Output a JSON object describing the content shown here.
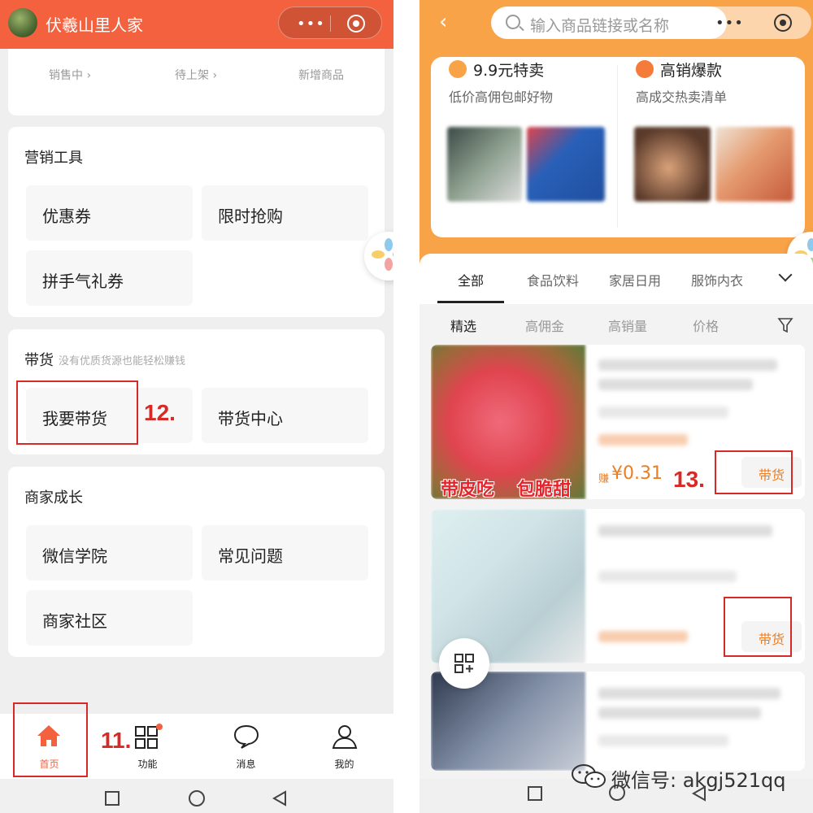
{
  "left": {
    "header": {
      "shop_name": "伏羲山里人家"
    },
    "stats": [
      "销售中 ›",
      "待上架 ›",
      "新增商品"
    ],
    "marketing": {
      "title": "营销工具",
      "items": [
        "优惠券",
        "限时抢购",
        "拼手气礼券"
      ]
    },
    "daihuo": {
      "title": "带货",
      "subtitle": "没有优质货源也能轻松赚钱",
      "items": [
        "我要带货",
        "带货中心"
      ]
    },
    "growth": {
      "title": "商家成长",
      "items": [
        "微信学院",
        "常见问题",
        "商家社区"
      ]
    },
    "tabbar": [
      {
        "label": "首页",
        "icon": "home-icon",
        "active": true
      },
      {
        "label": "功能",
        "icon": "grid-icon",
        "active": false
      },
      {
        "label": "消息",
        "icon": "chat-icon",
        "active": false
      },
      {
        "label": "我的",
        "icon": "user-icon",
        "active": false
      }
    ],
    "step_labels": {
      "home": "11.",
      "daihuo": "12."
    },
    "accent": "#f4613f"
  },
  "right": {
    "search": {
      "placeholder": "输入商品链接或名称"
    },
    "promo": [
      {
        "title": "9.9元特卖",
        "subtitle": "低价高佣包邮好物"
      },
      {
        "title": "高销爆款",
        "subtitle": "高成交热卖清单"
      }
    ],
    "categories": [
      "全部",
      "食品饮料",
      "家居日用",
      "服饰内衣"
    ],
    "filters": [
      "精选",
      "高佣金",
      "高销量",
      "价格"
    ],
    "products": [
      {
        "earn_prefix": "赚",
        "earn": "¥0.31",
        "button": "带货",
        "overlay": [
          "带皮吃",
          "包脆甜"
        ]
      },
      {
        "button": "带货"
      },
      {}
    ],
    "step_label": "13.",
    "watermark": "微信号: akgj521qq",
    "accent": "#f9a349"
  }
}
